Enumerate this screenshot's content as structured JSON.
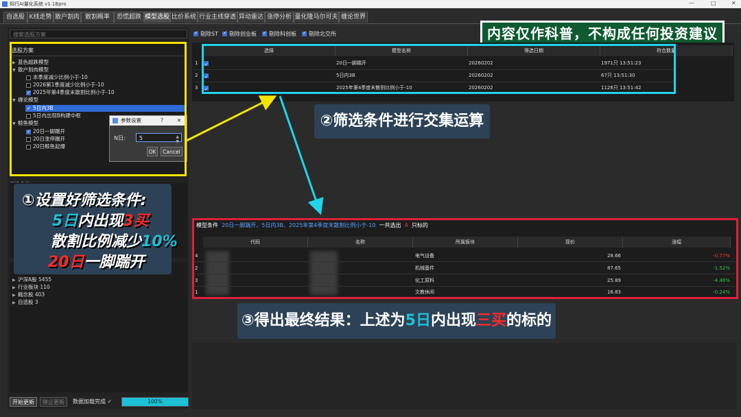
{
  "window": {
    "title": "知行AI量化系统 v1.1Bpro",
    "controls": [
      "—",
      "□",
      "✕"
    ]
  },
  "tabs": [
    "自选股",
    "K线走势",
    "散户割肉",
    "散割概率",
    "恐慌超跌",
    "模型选股",
    "比价系统",
    "行业主线穿透",
    "异动雷达",
    "涨停分析",
    "量化隆马尔可夫",
    "缠论世界"
  ],
  "active_tab_index": 5,
  "left": {
    "search_placeholder": "搜索选股方案",
    "tree_header": "选股方案",
    "tree": [
      {
        "label": "蓝色超跌模型",
        "level": 0
      },
      {
        "label": "散户割肉模型",
        "level": 0
      },
      {
        "label": "本季度减少比例小于-10",
        "level": 1,
        "checked": false
      },
      {
        "label": "2026第1季度减少比例小于-10",
        "level": 1,
        "checked": false
      },
      {
        "label": "2025年第4季度末散割比例小于-10",
        "level": 1,
        "checked": true
      },
      {
        "label": "缠论模型",
        "level": 0
      },
      {
        "label": "5日内3B",
        "level": 1,
        "checked": true,
        "selected": true
      },
      {
        "label": "5日内出现B构建中枢",
        "level": 1,
        "checked": false
      },
      {
        "label": "鲸鱼模型",
        "level": 0
      },
      {
        "label": "20日一脚踹开",
        "level": 1,
        "checked": true
      },
      {
        "label": "20日涨停踹开",
        "level": 1,
        "checked": false
      },
      {
        "label": "20日鲸鱼起爆",
        "level": 1,
        "checked": false
      }
    ],
    "dialog": {
      "title": "参数设置",
      "help": "?",
      "close": "✕",
      "field_label": "N日:",
      "field_value": "5",
      "ok": "OK",
      "cancel": "Cancel"
    },
    "mid_label": "置换条件",
    "stock_groups": [
      {
        "label": "沪深A股",
        "count": "5455"
      },
      {
        "label": "行业板块",
        "count": "110"
      },
      {
        "label": "概念股",
        "count": "403"
      },
      {
        "label": "自选股",
        "count": "3"
      }
    ],
    "start_button": "开始更新",
    "stop_button": "停止更新",
    "load_status": "数据加载完成 ✓",
    "progress": {
      "value": 100,
      "text": "100%"
    }
  },
  "filters": [
    {
      "label": "剔除ST",
      "checked": true
    },
    {
      "label": "剔除创业板",
      "checked": true
    },
    {
      "label": "剔除科创板",
      "checked": true
    },
    {
      "label": "剔除北交所",
      "checked": true
    }
  ],
  "conditions_table": {
    "headers": [
      "选择",
      "模型名称",
      "筛选日期",
      "符合数量"
    ],
    "rows": [
      {
        "idx": "1",
        "checked": true,
        "model": "20日一脚踹开",
        "date": "20260202",
        "count": "1971只 13:51:23"
      },
      {
        "idx": "2",
        "checked": true,
        "model": "5日内3B",
        "date": "20260202",
        "count": "67只 13:51:30"
      },
      {
        "idx": "3",
        "checked": true,
        "model": "2025年第4季度末散割比例小于-10",
        "date": "20260202",
        "count": "1126只 13:51:42"
      }
    ]
  },
  "result": {
    "prefix": "模型条件",
    "models": "20日一脚踹开、5日内3B、2025年第4季度末散割比例小于-10",
    "total_prefix": "一共选出",
    "total": "4",
    "total_suffix": "只标的",
    "headers": [
      "代码",
      "名称",
      "所属板块",
      "现价",
      "涨幅"
    ],
    "rows": [
      {
        "idx": "4",
        "sector": "电气设备",
        "price": "28.66",
        "change": "-0.77%",
        "color": "#ff3a3a"
      },
      {
        "idx": "2",
        "sector": "机械基件",
        "price": "87.65",
        "change": "-1.52%",
        "color": "#2bd14a"
      },
      {
        "idx": "3",
        "sector": "化工原料",
        "price": "25.89",
        "change": "-4.46%",
        "color": "#2bd14a"
      },
      {
        "idx": "1",
        "sector": "文教休闲",
        "price": "16.83",
        "change": "-0.24%",
        "color": "#2bd14a"
      }
    ]
  },
  "annotations": {
    "disclaimer": "内容仅作科普，不构成任何投资建议",
    "step2": "②筛选条件进行交集运算",
    "step1": {
      "line1": "①设置好筛选条件:",
      "line2a": "5日",
      "line2b": "内出现",
      "line2c": "3买",
      "line3a": "散割比例减少",
      "line3b": "10%",
      "line4a": "20日",
      "line4b": "一脚踹开"
    },
    "step3": {
      "a": "③得出最终结果：上述为",
      "b": "5日",
      "c": "内出现",
      "d": "三买",
      "e": "的标的"
    },
    "colors": {
      "yellow": "#f5e400",
      "cyan": "#1ed5ec",
      "red": "#e0203a",
      "highlight_red": "#ff2a2a",
      "highlight_blue": "#1ec0d6"
    }
  }
}
